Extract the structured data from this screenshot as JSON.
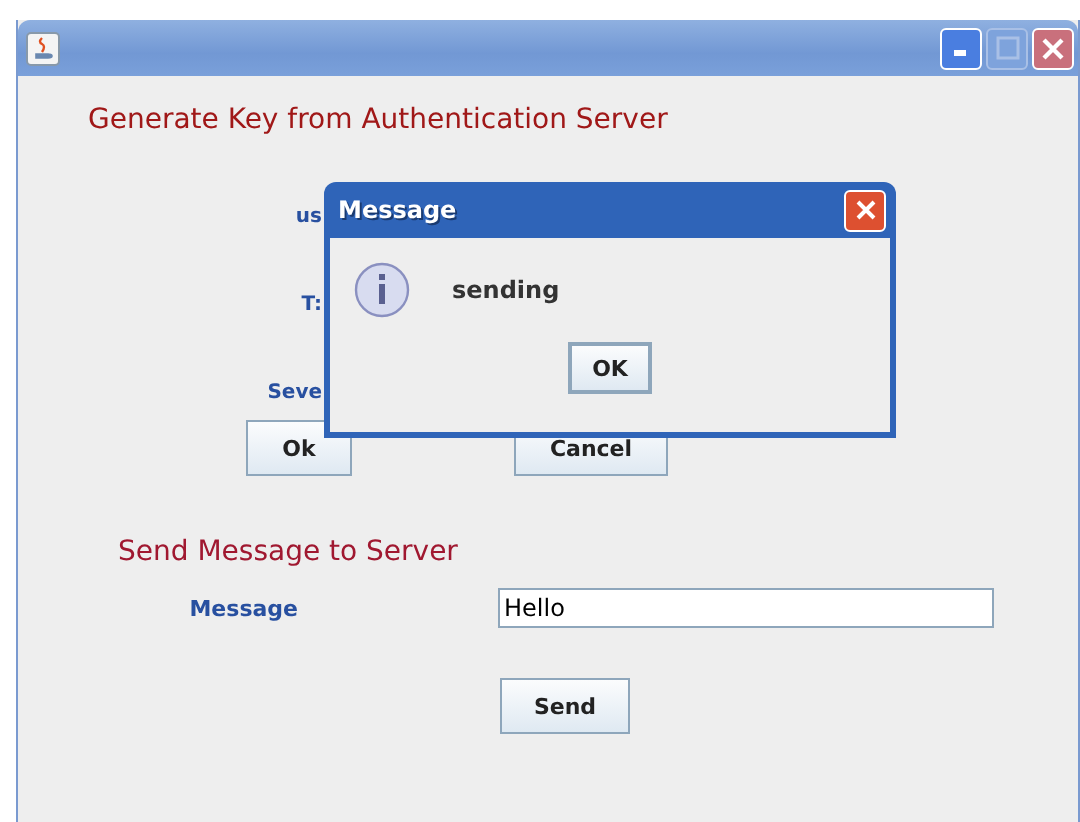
{
  "window": {
    "maximize_disabled": true
  },
  "key_section": {
    "heading": "Generate Key from Authentication Server",
    "fields": [
      {
        "label": "us"
      },
      {
        "label": "T:"
      },
      {
        "label": "Seve"
      }
    ],
    "buttons": [
      "Ok",
      "Cancel"
    ]
  },
  "message_section": {
    "heading": "Send Message to Server",
    "field_label": "Message",
    "value": "Hello",
    "button": "Send"
  },
  "dialog": {
    "title": "Message",
    "text": "sending",
    "button": "OK"
  }
}
